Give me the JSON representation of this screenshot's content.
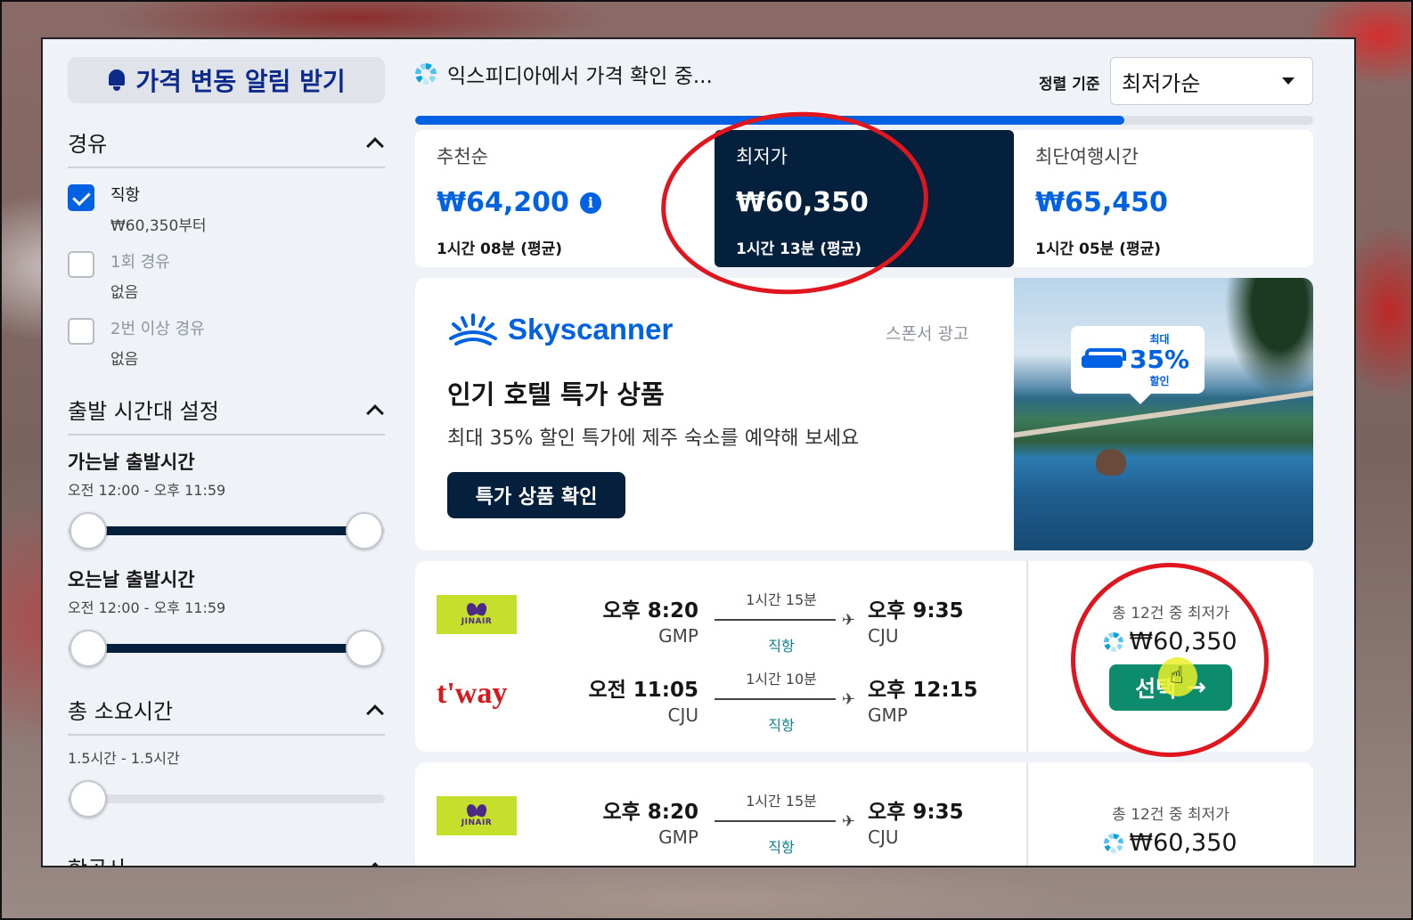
{
  "sidebar": {
    "price_alert_label": "가격 변동 알림 받기",
    "stops": {
      "title": "경유",
      "options": [
        {
          "label": "직항",
          "sub": "₩60,350부터",
          "checked": true
        },
        {
          "label": "1회 경유",
          "sub": "없음",
          "checked": false
        },
        {
          "label": "2번 이상 경유",
          "sub": "없음",
          "checked": false
        }
      ]
    },
    "departure_times": {
      "title": "출발 시간대 설정",
      "outbound": {
        "title": "가는날 출발시간",
        "range": "오전 12:00 - 오후 11:59"
      },
      "return": {
        "title": "오는날 출발시간",
        "range": "오전 12:00 - 오후 11:59"
      }
    },
    "duration": {
      "title": "총 소요시간",
      "range": "1.5시간 - 1.5시간"
    },
    "airlines": {
      "title": "항공사"
    }
  },
  "header": {
    "loading_text": "익스피디아에서 가격 확인 중...",
    "sort_label": "정렬 기준",
    "sort_value": "최저가순",
    "progress_fraction": 0.79
  },
  "tabs": [
    {
      "name": "추천순",
      "price": "₩64,200",
      "duration": "1시간 08분 (평균)",
      "active": false,
      "info": true
    },
    {
      "name": "최저가",
      "price": "₩60,350",
      "duration": "1시간 13분 (평균)",
      "active": true,
      "info": false
    },
    {
      "name": "최단여행시간",
      "price": "₩65,450",
      "duration": "1시간 05분 (평균)",
      "active": false,
      "info": false
    }
  ],
  "ad": {
    "brand": "Skyscanner",
    "sponsor_label": "스폰서 광고",
    "title": "인기 호텔 특가 상품",
    "description": "최대 35% 할인 특가에 제주 숙소를 예약해 보세요",
    "button_label": "특가 상품 확인",
    "badge_top": "최대",
    "badge_percent": "35%",
    "badge_bottom": "할인"
  },
  "results": [
    {
      "legs": [
        {
          "airline": "JINAIR",
          "dep_time": "오후 8:20",
          "dep_code": "GMP",
          "duration": "1시간 15분",
          "stops": "직항",
          "arr_time": "오후 9:35",
          "arr_code": "CJU"
        },
        {
          "airline": "t'way",
          "dep_time": "오전 11:05",
          "dep_code": "CJU",
          "duration": "1시간 10분",
          "stops": "직항",
          "arr_time": "오후 12:15",
          "arr_code": "GMP"
        }
      ],
      "price_note": "총 12건 중 최저가",
      "price": "₩60,350",
      "select_label": "선택"
    },
    {
      "legs": [
        {
          "airline": "JINAIR",
          "dep_time": "오후 8:20",
          "dep_code": "GMP",
          "duration": "1시간 15분",
          "stops": "직항",
          "arr_time": "오후 9:35",
          "arr_code": "CJU"
        }
      ],
      "price_note": "총 12건 중 최저가",
      "price": "₩60,350"
    }
  ],
  "colors": {
    "accent": "#0062e3",
    "dark_navy": "#05203c",
    "select_green": "#0c8b6d",
    "annotation_red": "#e0161e"
  }
}
